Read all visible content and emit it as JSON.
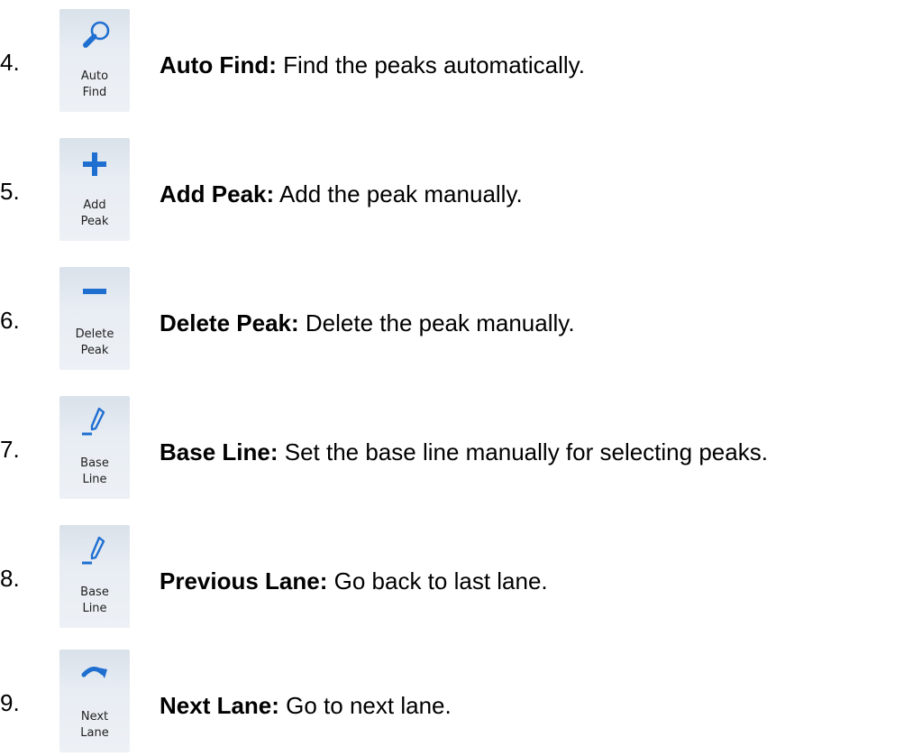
{
  "accent_color": "#1f6fd1",
  "items": [
    {
      "number": "4.",
      "icon": "magnifier-icon",
      "tool_label_1": "Auto",
      "tool_label_2": "Find",
      "term": "Auto Find:",
      "description": " Find the peaks automatically."
    },
    {
      "number": "5.",
      "icon": "plus-icon",
      "tool_label_1": "Add",
      "tool_label_2": "Peak",
      "term": "Add Peak:",
      "description": " Add the peak manually."
    },
    {
      "number": "6.",
      "icon": "minus-icon",
      "tool_label_1": "Delete",
      "tool_label_2": "Peak",
      "term": "Delete Peak:",
      "description": " Delete the peak manually."
    },
    {
      "number": "7.",
      "icon": "pen-icon",
      "tool_label_1": "Base",
      "tool_label_2": "Line",
      "term": "Base Line:",
      "description": " Set the base line manually for selecting peaks."
    },
    {
      "number": "8.",
      "icon": "pen-icon",
      "tool_label_1": "Base",
      "tool_label_2": "Line",
      "term": "Previous Lane:",
      "description": " Go back to last lane."
    },
    {
      "number": "9.",
      "icon": "curved-arrow-icon",
      "tool_label_1": "Next",
      "tool_label_2": "Lane",
      "term": "Next Lane:",
      "description": " Go to next lane."
    }
  ]
}
